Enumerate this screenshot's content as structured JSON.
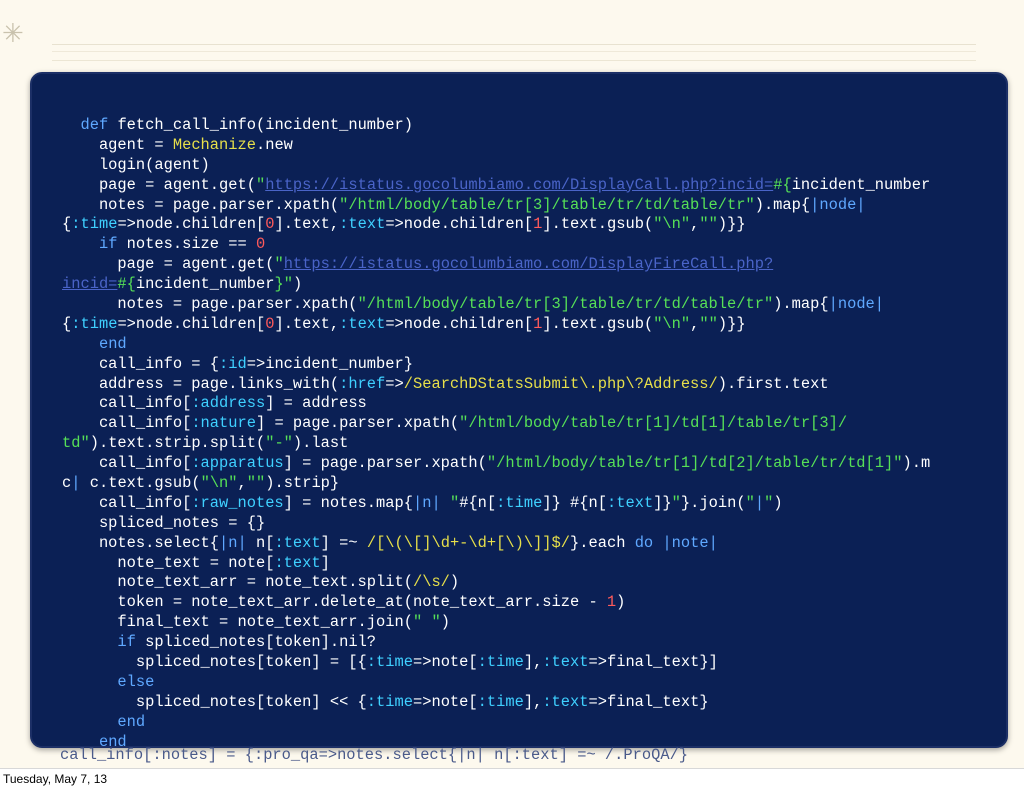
{
  "colors": {
    "background": "#fdf9ee",
    "panel": "#0b2055",
    "text": "#ffffff",
    "keyword": "#5fa8ff",
    "symbol": "#3fd0ff",
    "string": "#56e057",
    "number": "#ff5a5a",
    "constant": "#e7df4a",
    "url": "#4a64c8"
  },
  "code_lines": [
    [
      {
        "t": "  "
      },
      {
        "t": "def",
        "c": "keyword"
      },
      {
        "t": " fetch_call_info(incident_number)"
      }
    ],
    [
      {
        "t": "    agent = "
      },
      {
        "t": "Mechanize",
        "c": "constant"
      },
      {
        "t": ".new"
      }
    ],
    [
      {
        "t": "    login(agent)"
      }
    ],
    [
      {
        "t": "    page = agent.get("
      },
      {
        "t": "\"",
        "c": "string"
      },
      {
        "t": "https://istatus.gocolumbiamo.com/DisplayCall.php?incid=",
        "c": "url"
      },
      {
        "t": "#{",
        "c": "string"
      },
      {
        "t": "incident_number"
      }
    ],
    [
      {
        "t": "    notes = page.parser.xpath("
      },
      {
        "t": "\"/html/body/table/tr[3]/table/tr/td/table/tr\"",
        "c": "string"
      },
      {
        "t": ").map{"
      },
      {
        "t": "|node|",
        "c": "keyword"
      }
    ],
    [
      {
        "t": "{"
      },
      {
        "t": ":time",
        "c": "symbol"
      },
      {
        "t": "=>node.children["
      },
      {
        "t": "0",
        "c": "number"
      },
      {
        "t": "].text,"
      },
      {
        "t": ":text",
        "c": "symbol"
      },
      {
        "t": "=>node.children["
      },
      {
        "t": "1",
        "c": "number"
      },
      {
        "t": "].text.gsub("
      },
      {
        "t": "\"\\n\"",
        "c": "string"
      },
      {
        "t": ","
      },
      {
        "t": "\"\"",
        "c": "string"
      },
      {
        "t": ")}}"
      }
    ],
    [
      {
        "t": "    "
      },
      {
        "t": "if",
        "c": "keyword"
      },
      {
        "t": " notes.size == "
      },
      {
        "t": "0",
        "c": "number"
      }
    ],
    [
      {
        "t": "      page = agent.get("
      },
      {
        "t": "\"",
        "c": "string"
      },
      {
        "t": "https://istatus.gocolumbiamo.com/DisplayFireCall.php?",
        "c": "url"
      }
    ],
    [
      {
        "t": "incid=",
        "c": "url"
      },
      {
        "t": "#{",
        "c": "string"
      },
      {
        "t": "incident_number"
      },
      {
        "t": "}\"",
        "c": "string"
      },
      {
        "t": ")"
      }
    ],
    [
      {
        "t": "      notes = page.parser.xpath("
      },
      {
        "t": "\"/html/body/table/tr[3]/table/tr/td/table/tr\"",
        "c": "string"
      },
      {
        "t": ").map{"
      },
      {
        "t": "|node|",
        "c": "keyword"
      }
    ],
    [
      {
        "t": "{"
      },
      {
        "t": ":time",
        "c": "symbol"
      },
      {
        "t": "=>node.children["
      },
      {
        "t": "0",
        "c": "number"
      },
      {
        "t": "].text,"
      },
      {
        "t": ":text",
        "c": "symbol"
      },
      {
        "t": "=>node.children["
      },
      {
        "t": "1",
        "c": "number"
      },
      {
        "t": "].text.gsub("
      },
      {
        "t": "\"\\n\"",
        "c": "string"
      },
      {
        "t": ","
      },
      {
        "t": "\"\"",
        "c": "string"
      },
      {
        "t": ")}}"
      }
    ],
    [
      {
        "t": "    "
      },
      {
        "t": "end",
        "c": "keyword"
      }
    ],
    [
      {
        "t": "    call_info = {"
      },
      {
        "t": ":id",
        "c": "symbol"
      },
      {
        "t": "=>incident_number}"
      }
    ],
    [
      {
        "t": "    address = page.links_with("
      },
      {
        "t": ":href",
        "c": "symbol"
      },
      {
        "t": "=>"
      },
      {
        "t": "/SearchDStatsSubmit\\.php\\?Address/",
        "c": "constant"
      },
      {
        "t": ").first.text"
      }
    ],
    [
      {
        "t": "    call_info["
      },
      {
        "t": ":address",
        "c": "symbol"
      },
      {
        "t": "] = address"
      }
    ],
    [
      {
        "t": "    call_info["
      },
      {
        "t": ":nature",
        "c": "symbol"
      },
      {
        "t": "] = page.parser.xpath("
      },
      {
        "t": "\"/html/body/table/tr[1]/td[1]/table/tr[3]/",
        "c": "string"
      }
    ],
    [
      {
        "t": "td\"",
        "c": "string"
      },
      {
        "t": ").text.strip.split("
      },
      {
        "t": "\"-\"",
        "c": "string"
      },
      {
        "t": ").last"
      }
    ],
    [
      {
        "t": "    call_info["
      },
      {
        "t": ":apparatus",
        "c": "symbol"
      },
      {
        "t": "] = page.parser.xpath("
      },
      {
        "t": "\"/html/body/table/tr[1]/td[2]/table/tr/td[1]\"",
        "c": "string"
      },
      {
        "t": ").m"
      }
    ],
    [
      {
        "t": "c"
      },
      {
        "t": "|",
        "c": "keyword"
      },
      {
        "t": " c.text.gsub("
      },
      {
        "t": "\"\\n\"",
        "c": "string"
      },
      {
        "t": ","
      },
      {
        "t": "\"\"",
        "c": "string"
      },
      {
        "t": ").strip}"
      }
    ],
    [
      {
        "t": "    call_info["
      },
      {
        "t": ":raw_notes",
        "c": "symbol"
      },
      {
        "t": "] = notes.map{"
      },
      {
        "t": "|n|",
        "c": "keyword"
      },
      {
        "t": " "
      },
      {
        "t": "\"",
        "c": "string"
      },
      {
        "t": "#{n["
      },
      {
        "t": ":time",
        "c": "symbol"
      },
      {
        "t": "]} #{n["
      },
      {
        "t": ":text",
        "c": "symbol"
      },
      {
        "t": "]}"
      },
      {
        "t": "\"",
        "c": "string"
      },
      {
        "t": "}.join("
      },
      {
        "t": "\"",
        "c": "string"
      },
      {
        "t": "|",
        "c": "keyword"
      },
      {
        "t": "\"",
        "c": "string"
      },
      {
        "t": ")"
      }
    ],
    [
      {
        "t": "    spliced_notes = {}"
      }
    ],
    [
      {
        "t": "    notes.select{"
      },
      {
        "t": "|n|",
        "c": "keyword"
      },
      {
        "t": " n["
      },
      {
        "t": ":text",
        "c": "symbol"
      },
      {
        "t": "] =~ "
      },
      {
        "t": "/[\\(\\[]\\d+-\\d+[\\)\\]]$/",
        "c": "constant"
      },
      {
        "t": "}.each "
      },
      {
        "t": "do",
        "c": "keyword"
      },
      {
        "t": " "
      },
      {
        "t": "|note|",
        "c": "keyword"
      }
    ],
    [
      {
        "t": "      note_text = note["
      },
      {
        "t": ":text",
        "c": "symbol"
      },
      {
        "t": "]"
      }
    ],
    [
      {
        "t": "      note_text_arr = note_text.split("
      },
      {
        "t": "/\\s/",
        "c": "constant"
      },
      {
        "t": ")"
      }
    ],
    [
      {
        "t": "      token = note_text_arr.delete_at(note_text_arr.size - "
      },
      {
        "t": "1",
        "c": "number"
      },
      {
        "t": ")"
      }
    ],
    [
      {
        "t": "      final_text = note_text_arr.join("
      },
      {
        "t": "\" \"",
        "c": "string"
      },
      {
        "t": ")"
      }
    ],
    [
      {
        "t": "      "
      },
      {
        "t": "if",
        "c": "keyword"
      },
      {
        "t": " spliced_notes[token].nil?"
      }
    ],
    [
      {
        "t": "        spliced_notes[token] = [{"
      },
      {
        "t": ":time",
        "c": "symbol"
      },
      {
        "t": "=>note["
      },
      {
        "t": ":time",
        "c": "symbol"
      },
      {
        "t": "],"
      },
      {
        "t": ":text",
        "c": "symbol"
      },
      {
        "t": "=>final_text}]"
      }
    ],
    [
      {
        "t": "      "
      },
      {
        "t": "else",
        "c": "keyword"
      }
    ],
    [
      {
        "t": "        spliced_notes[token] << {"
      },
      {
        "t": ":time",
        "c": "symbol"
      },
      {
        "t": "=>note["
      },
      {
        "t": ":time",
        "c": "symbol"
      },
      {
        "t": "],"
      },
      {
        "t": ":text",
        "c": "symbol"
      },
      {
        "t": "=>final_text}"
      }
    ],
    [
      {
        "t": "      "
      },
      {
        "t": "end",
        "c": "keyword"
      }
    ],
    [
      {
        "t": "    "
      },
      {
        "t": "end",
        "c": "keyword"
      }
    ]
  ],
  "overflow_line": "call_info[:notes] = {:pro_qa=>notes.select{|n| n[:text] =~ /.ProQA/}",
  "footer": {
    "date": "Tuesday, May 7, 13"
  }
}
